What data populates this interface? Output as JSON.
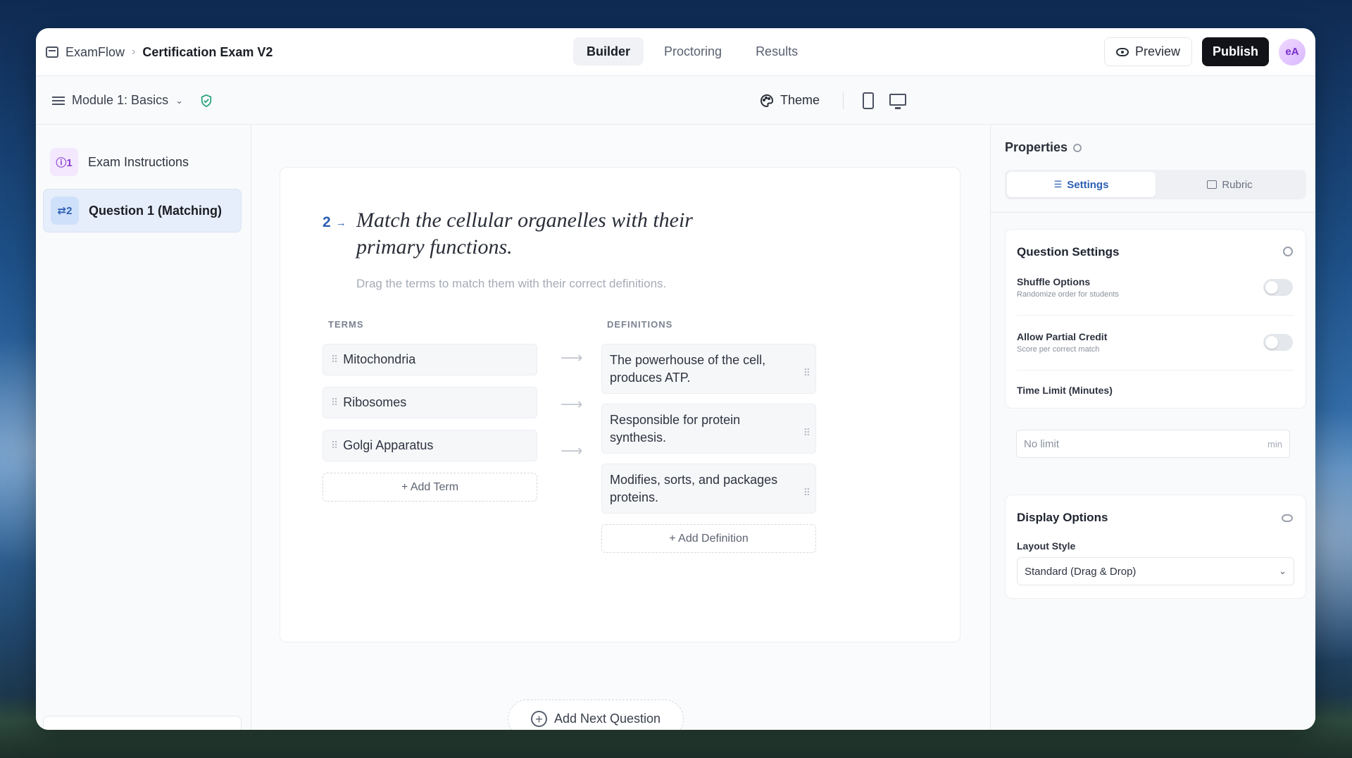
{
  "topbar": {
    "app_name": "ExamFlow",
    "doc_title": "Certification Exam V2",
    "tabs": [
      "Builder",
      "Proctoring",
      "Results"
    ],
    "active_tab": "Builder",
    "preview_label": "Preview",
    "publish_label": "Publish",
    "avatar_initials": "eA"
  },
  "subbar": {
    "module_label": "Module 1: Basics",
    "theme_label": "Theme"
  },
  "sidebar": {
    "items": [
      {
        "badge": "ⓘ1",
        "label": "Exam Instructions"
      },
      {
        "badge": "⇄2",
        "label": "Question 1 (Matching)"
      }
    ]
  },
  "question": {
    "number": "2",
    "title": "Match the cellular organelles with their primary functions.",
    "description": "Drag the terms to match them with their correct definitions.",
    "terms_header": "TERMS",
    "definitions_header": "DEFINITIONS",
    "terms": [
      "Mitochondria",
      "Ribosomes",
      "Golgi Apparatus"
    ],
    "definitions": [
      "The powerhouse of the cell, produces ATP.",
      "Responsible for protein synthesis.",
      "Modifies, sorts, and packages proteins."
    ],
    "add_term_label": "+ Add Term",
    "add_definition_label": "+ Add Definition",
    "add_next_label": "Add Next Question"
  },
  "properties": {
    "title": "Properties",
    "tabs": [
      "Settings",
      "Rubric"
    ],
    "question_settings": {
      "title": "Question Settings",
      "shuffle_label": "Shuffle Options",
      "shuffle_sub": "Randomize order for students",
      "shuffle_on": false,
      "partial_label": "Allow Partial Credit",
      "partial_sub": "Score per correct match",
      "partial_on": false,
      "time_label": "Time Limit (Minutes)",
      "time_placeholder": "No limit",
      "time_unit": "min"
    },
    "display_options": {
      "title": "Display Options",
      "layout_label": "Layout Style",
      "layout_value": "Standard (Drag & Drop)"
    }
  },
  "colors": {
    "accent": "#2c5fb3",
    "publish": "#111318",
    "success": "#2aa37a"
  }
}
